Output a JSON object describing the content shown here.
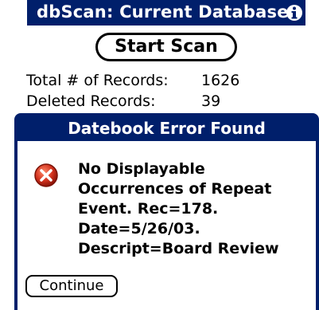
{
  "titlebar": {
    "title": "dbScan: Current Database",
    "info_icon": "info-icon"
  },
  "scan": {
    "start_label": "Start Scan"
  },
  "stats": {
    "total_label": "Total # of Records:",
    "total_value": "1626",
    "deleted_label": "Deleted Records:",
    "deleted_value": "39"
  },
  "dialog": {
    "title": "Datebook Error Found",
    "icon": "error-icon",
    "message_lines": [
      "No Displayable",
      "Occurrences of Repeat",
      "Event. Rec=178.",
      "Date=5/26/03.",
      "Descript=Board Review"
    ],
    "continue_label": "Continue"
  },
  "colors": {
    "title_bar": "#001f6b",
    "error_red": "#d2321e"
  }
}
